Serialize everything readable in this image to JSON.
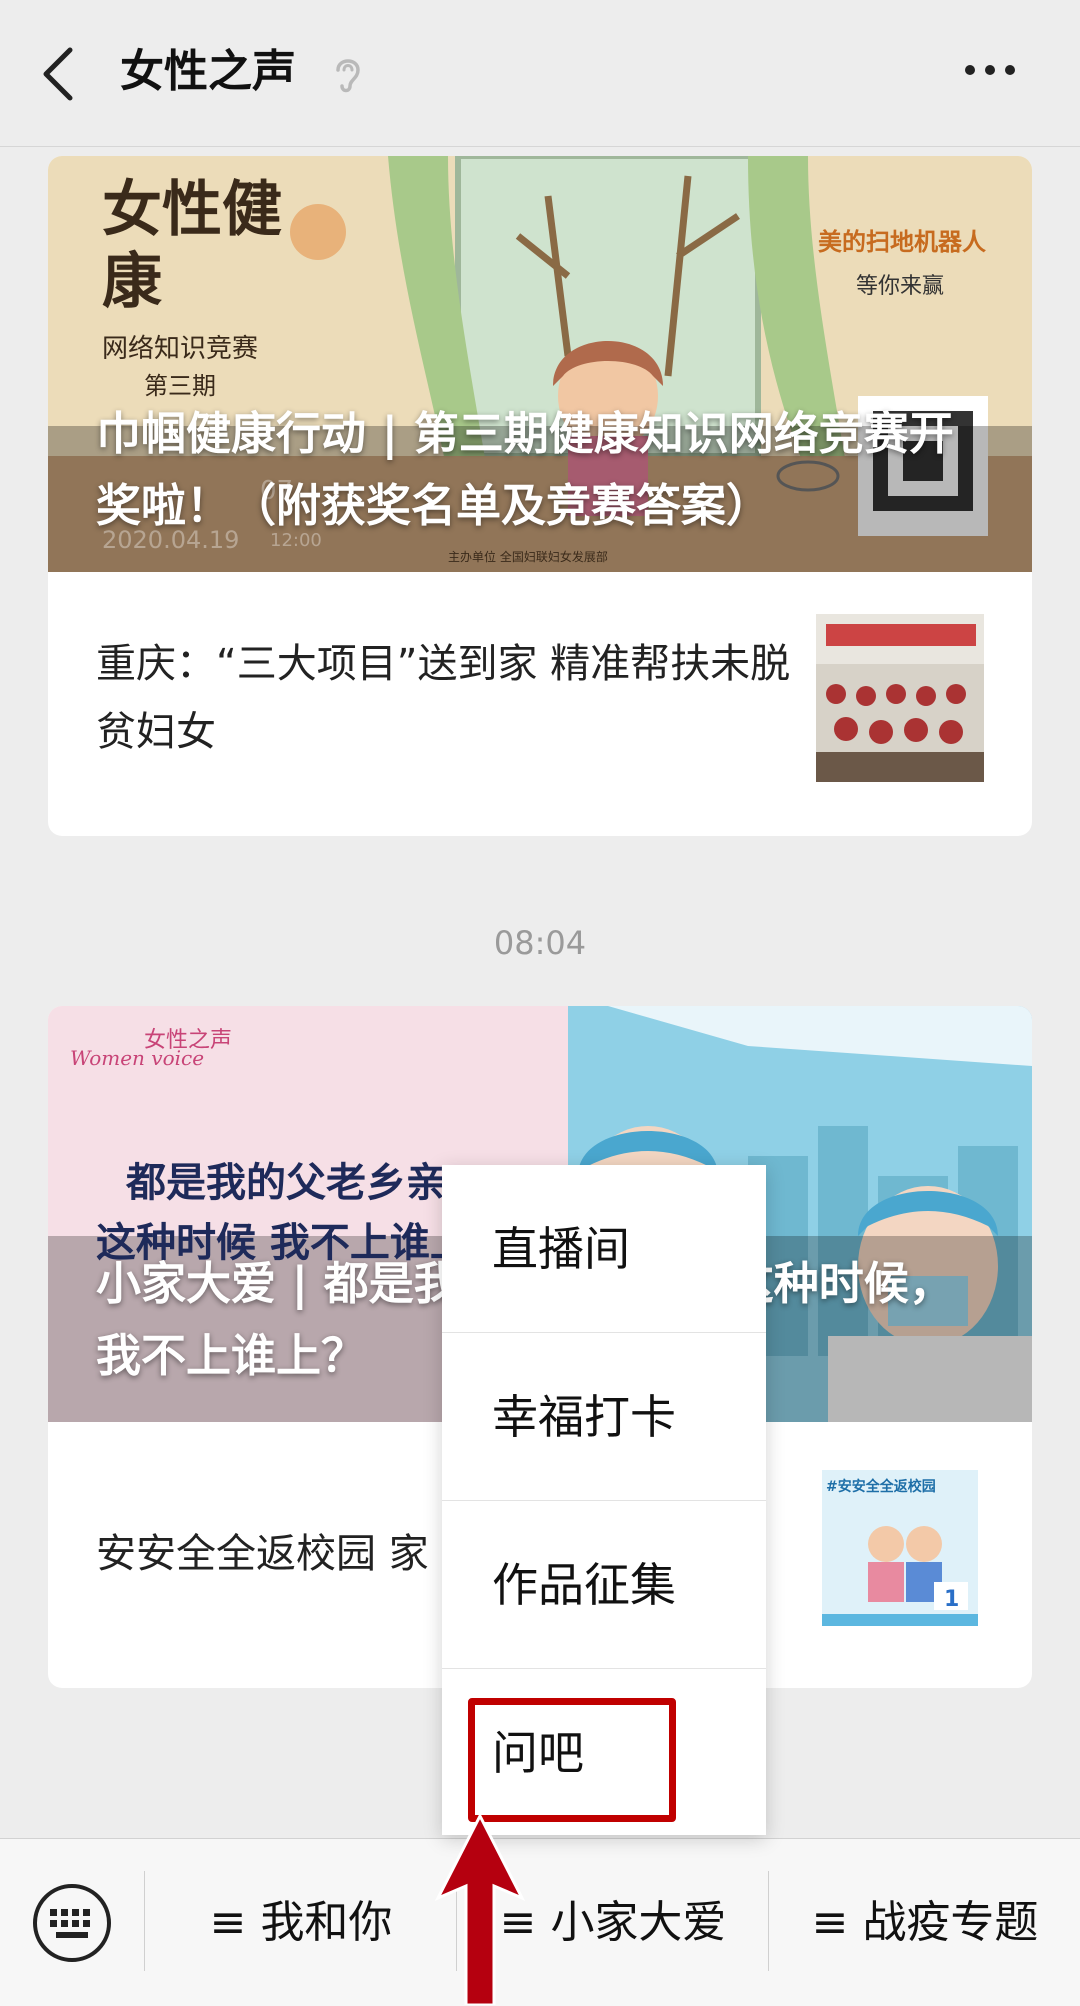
{
  "header": {
    "title": "女性之声"
  },
  "articles": [
    {
      "cover_title": "巾帼健康行动 | 第三期健康知识网络竞赛开奖啦！（附获奖名单及竞赛答案）",
      "cover_art": {
        "headline": "女性健康",
        "subtitle": "网络知识竞赛",
        "period": "第三期",
        "prize_line1": "美的扫地机器人",
        "prize_line2": "等你来赢",
        "date": "2020.04.19",
        "date_top": "07",
        "time": "12:00",
        "organizer": "主办单位  全国妇联妇女发展部"
      },
      "sub_title": "重庆：“三大项目”送到家 精准帮扶未脱贫妇女"
    },
    {
      "cover_title": "小家大爱 | 都是我的父老乡亲，这种时候，我不上谁上？",
      "cover_art": {
        "slogan_line1": "都是我的父老乡亲",
        "slogan_line2": "这种时候 我不上谁上",
        "brand_cn": "女性之声",
        "brand_en": "Women voice",
        "thumb_text": "#安安全全返校园"
      },
      "sub_title": "安安全全返校园 家"
    }
  ],
  "timestamp": "08:04",
  "menu": {
    "items": [
      "直播间",
      "幸福打卡",
      "作品征集",
      "问吧"
    ]
  },
  "bottom_bar": {
    "tabs": [
      {
        "icon": "≡",
        "label": "我和你"
      },
      {
        "icon": "≡",
        "label": "小家大爱"
      },
      {
        "icon": "≡",
        "label": "战疫专题"
      }
    ]
  },
  "colors": {
    "highlight": "#c00000",
    "background": "#ededed"
  }
}
